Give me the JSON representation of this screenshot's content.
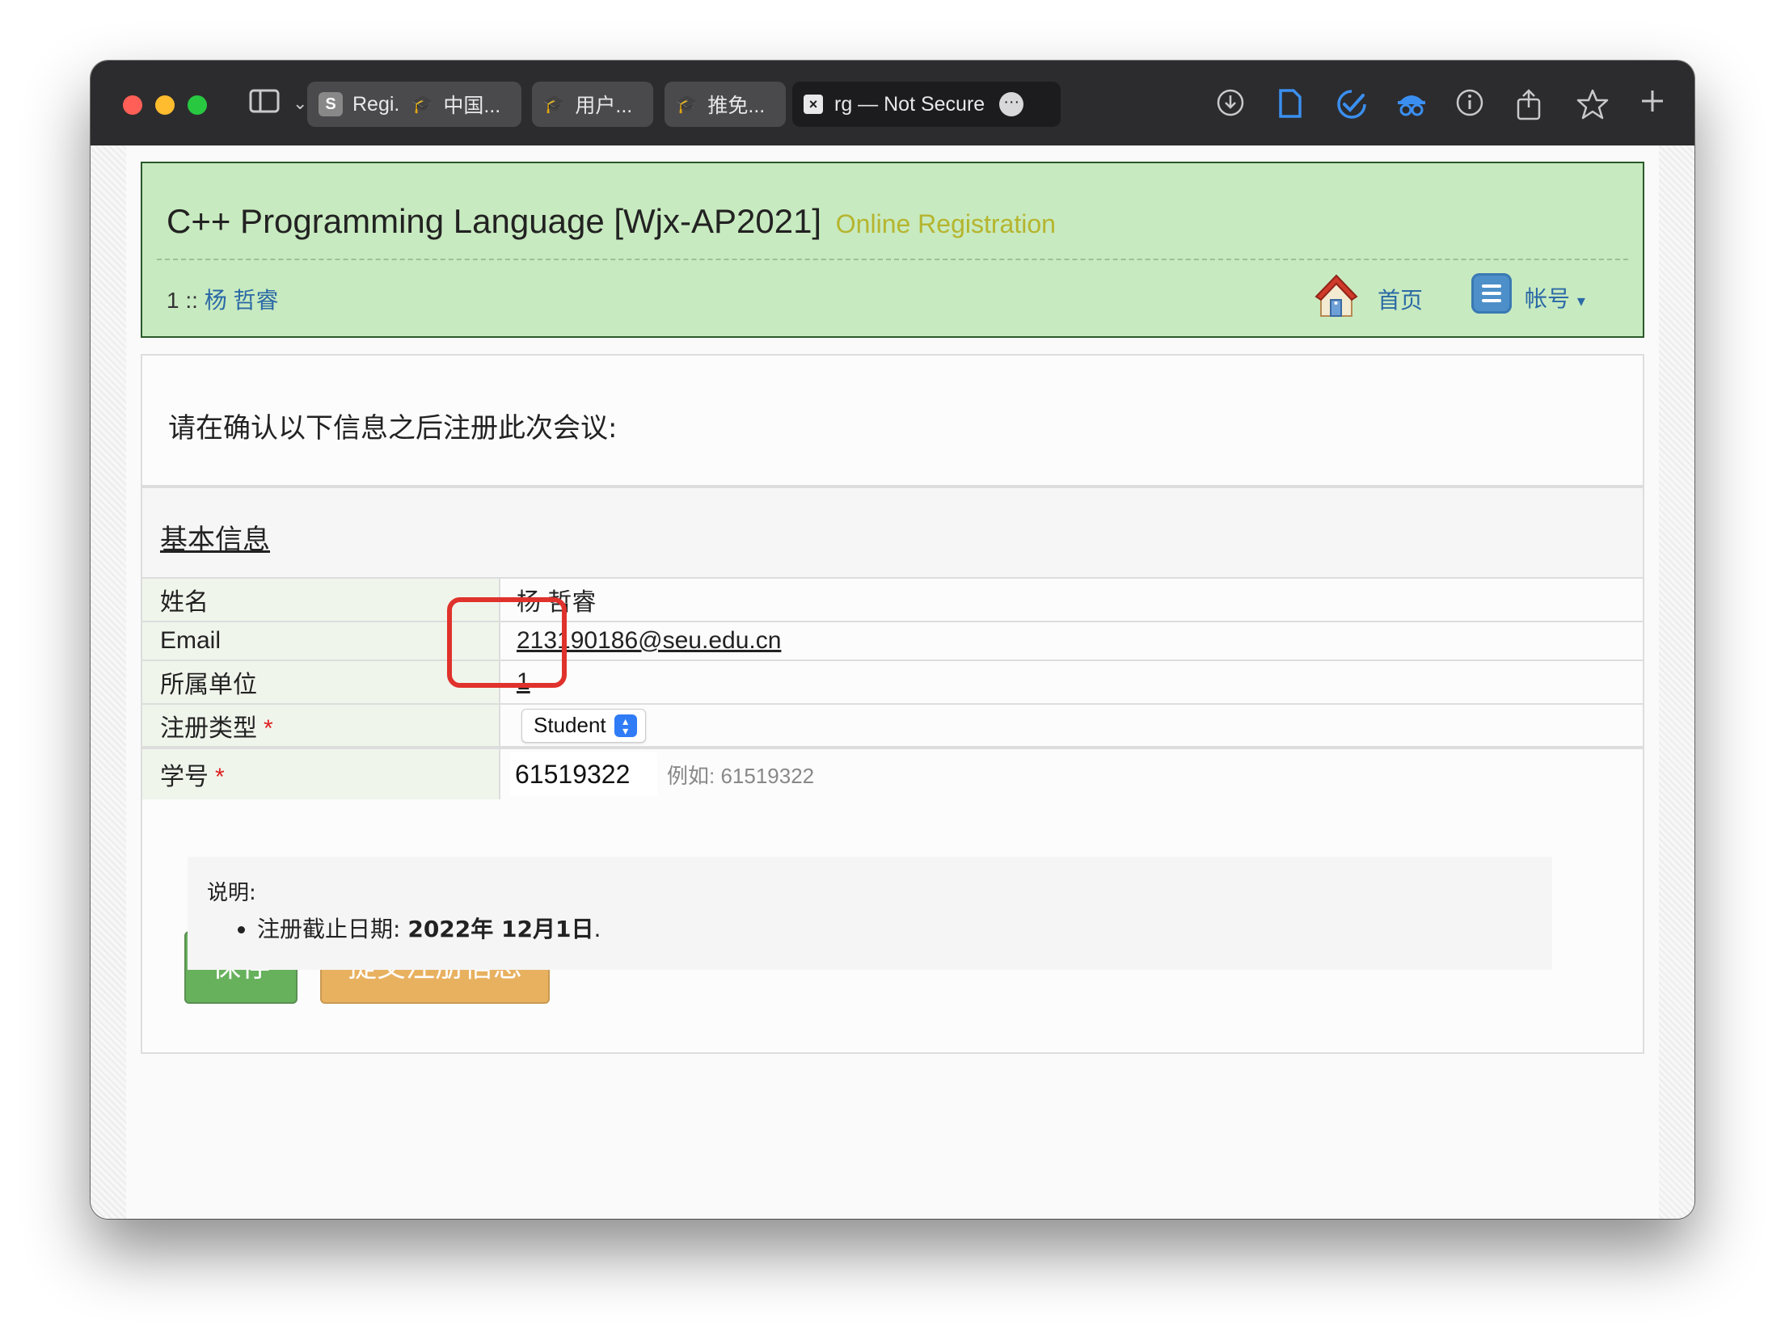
{
  "browser": {
    "tabs": [
      {
        "label": "Regi...",
        "favicon": "S"
      },
      {
        "label": "中国...",
        "favicon": "graduation-cap"
      },
      {
        "label": "用户...",
        "favicon": "graduation-cap"
      },
      {
        "label": "推免...",
        "favicon": "graduation-cap"
      },
      {
        "label": "rg — Not Secure",
        "favicon": "close-x",
        "active": true
      }
    ]
  },
  "header": {
    "title": "C++ Programming Language [Wjx-AP2021]",
    "subtitle": "Online Registration",
    "user_id": "1",
    "user_sep": " :: ",
    "user_name": "杨 哲睿",
    "home_label": "首页",
    "account_label": "帐号",
    "account_caret": "▾"
  },
  "form": {
    "intro": "请在确认以下信息之后注册此次会议:",
    "section_title": "基本信息",
    "rows": {
      "name": {
        "label": "姓名",
        "value": "杨 哲睿"
      },
      "email": {
        "label": "Email",
        "value": "213190186@seu.edu.cn"
      },
      "org": {
        "label": "所属单位",
        "value": "1"
      },
      "reg_type": {
        "label": "注册类型",
        "value": "Student",
        "required": "*"
      },
      "student_id": {
        "label": "学号",
        "value": "61519322",
        "required": "*",
        "example": "例如: 61519322"
      }
    },
    "save_label": "保存",
    "submit_label": "提交注册信息"
  },
  "notes": {
    "title": "说明:",
    "deadline_label": "注册截止日期: ",
    "deadline_value": "2022年 12月1日",
    "deadline_suffix": "."
  },
  "colors": {
    "header_bg": "#c8eac0",
    "link": "#2b6aa6",
    "save_btn": "#67b15d",
    "submit_btn": "#e8b160",
    "highlight": "#e0322c"
  }
}
